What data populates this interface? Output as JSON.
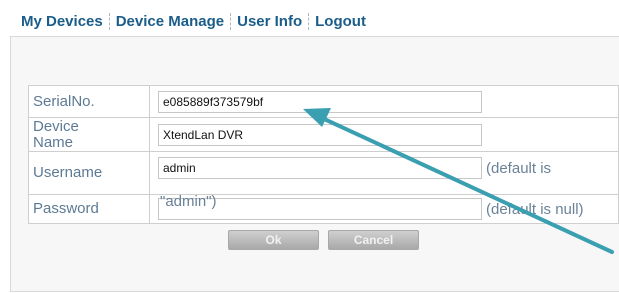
{
  "nav": {
    "items": [
      {
        "label": "My Devices"
      },
      {
        "label": "Device Manage"
      },
      {
        "label": "User Info"
      },
      {
        "label": "Logout"
      }
    ]
  },
  "form": {
    "serial": {
      "label": "SerialNo.",
      "value": "e085889f373579bf"
    },
    "device_name": {
      "label_line1": "Device",
      "label_line2": "Name",
      "value": "XtendLan DVR"
    },
    "username": {
      "label": "Username",
      "value": "admin",
      "hint_line1": "(default is",
      "hint_line2": "\"admin\")"
    },
    "password": {
      "label": "Password",
      "value": "",
      "hint": "(default is null)"
    },
    "buttons": {
      "ok": "Ok",
      "cancel": "Cancel"
    }
  },
  "colors": {
    "nav_link": "#1a5d8a",
    "label": "#5d7a95",
    "arrow": "#3a9fb0",
    "button": "#b4b4b4"
  },
  "annotation": {
    "icon": "arrow-icon"
  }
}
